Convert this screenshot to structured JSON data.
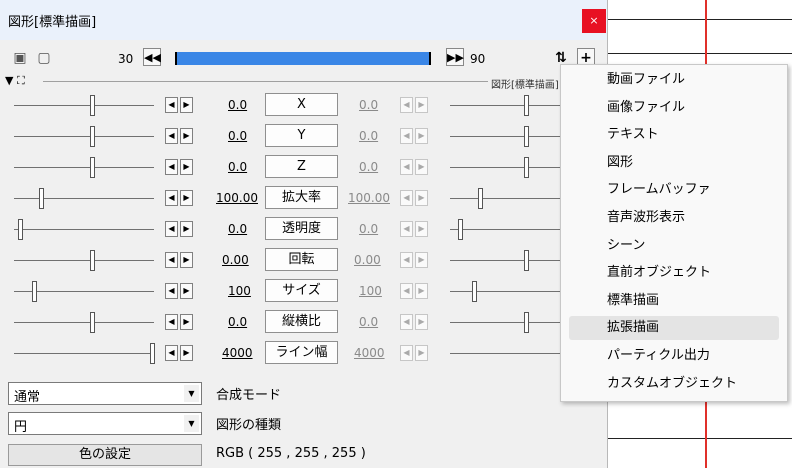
{
  "window": {
    "title": "図形[標準描画]",
    "close_label": "×"
  },
  "toolbar": {
    "start_frame": "30",
    "end_frame": "90",
    "prev_label": "◀◀",
    "next_label": "▶▶",
    "sync_icon": "sync-icon",
    "add_label": "+"
  },
  "group": {
    "name": "図形[標準描画]"
  },
  "params": [
    {
      "name": "X",
      "start": "0.0",
      "end": "0.0"
    },
    {
      "name": "Y",
      "start": "0.0",
      "end": "0.0"
    },
    {
      "name": "Z",
      "start": "0.0",
      "end": "0.0"
    },
    {
      "name": "拡大率",
      "start": "100.00",
      "end": "100.00"
    },
    {
      "name": "透明度",
      "start": "0.0",
      "end": "0.0"
    },
    {
      "name": "回転",
      "start": "0.00",
      "end": "0.00"
    },
    {
      "name": "サイズ",
      "start": "100",
      "end": "100"
    },
    {
      "name": "縦横比",
      "start": "0.0",
      "end": "0.0"
    },
    {
      "name": "ライン幅",
      "start": "4000",
      "end": "4000"
    }
  ],
  "blend": {
    "value": "通常",
    "label": "合成モード"
  },
  "shape": {
    "value": "円",
    "label": "図形の種類"
  },
  "color": {
    "button_label": "色の設定",
    "rgb_text": "RGB ( 255 , 255 , 255 )"
  },
  "menu": {
    "items": [
      "動画ファイル",
      "画像ファイル",
      "テキスト",
      "図形",
      "フレームバッファ",
      "音声波形表示",
      "シーン",
      "直前オブジェクト",
      "標準描画",
      "拡張描画",
      "パーティクル出力",
      "カスタムオブジェクト"
    ],
    "highlighted": "拡張描画"
  },
  "colors": {
    "accent_bar": "#3a86e6",
    "close_bg": "#e81123",
    "timeline_marker": "#e0302a"
  }
}
